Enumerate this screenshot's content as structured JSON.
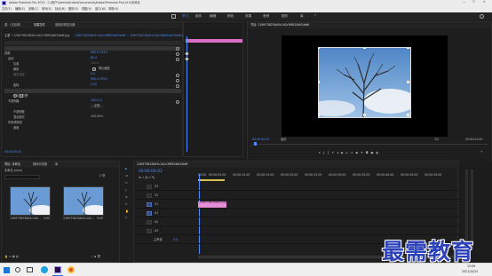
{
  "titlebar": {
    "title": "Adobe Premiere Pro 2020 - C:\\用户\\Administrator\\Documents\\Adobe\\Premiere Pro\\14.0\\未命名"
  },
  "menu": [
    "文件(F)",
    "编辑(E)",
    "剪辑(C)",
    "序列(S)",
    "标记(M)",
    "图形(G)",
    "视图(V)",
    "窗口(W)",
    "帮助(H)"
  ],
  "workspaces": [
    "学习",
    "组件",
    "编辑",
    "颜色",
    "效果",
    "音频",
    "图形",
    "库"
  ],
  "effect_controls": {
    "tabs": [
      "源：(无剪辑)",
      "效果控件",
      "音频剪辑混合器"
    ],
    "source_label": "主要 * 1269738258d3c1d2c3f8924bf24b6f.jpg",
    "clip_label": "1269738258d3c1d2c3f8924bf24b6f ~ 1269738258d3c1d2c3f8924bf24b6f.jpg",
    "rows": [
      {
        "label": "视频",
        "value": ""
      },
      {
        "label": "运动",
        "value": ""
      },
      {
        "label": "位置",
        "value": "960.0   539.0"
      },
      {
        "label": "缩放",
        "value": "85.0"
      },
      {
        "label": "缩放宽度",
        "value": "100.0"
      },
      {
        "label": "等比缩放",
        "value": ""
      },
      {
        "label": "旋转",
        "value": "0.0"
      },
      {
        "label": "锚点",
        "value": "960.0   539.0"
      },
      {
        "label": "防闪烁滤镜",
        "value": "0.00"
      },
      {
        "label": "不透明度",
        "value": ""
      },
      {
        "label": "不透明度",
        "value": "100.0 %"
      },
      {
        "label": "混合模式",
        "value": "正常"
      },
      {
        "label": "时间重映射",
        "value": ""
      },
      {
        "label": "速度",
        "value": "100.00%"
      }
    ],
    "time": "00:00:00:02"
  },
  "program": {
    "tab": "节目: 1269738258d3c1d2c3f8924bf24b6f",
    "timecode_left": "00:00:00:02",
    "fit": "适合",
    "quality": "1/2",
    "timecode_right": "00:00:01:00"
  },
  "project": {
    "tabs": [
      "项目: 未命名",
      "媒体浏览器",
      "库"
    ],
    "path": "未命名.prproj",
    "count": "2 项",
    "items": [
      {
        "name": "1269738258d3c1d2...",
        "duration": "5:00"
      },
      {
        "name": "1269738258d3c1d2...",
        "duration": "5:00"
      }
    ]
  },
  "timeline": {
    "tab": "1269738258d3c1d2c3f8924bf24b6f",
    "timecode": "00:00:00:02",
    "ruler": [
      "00:00",
      "00:00:05:00",
      "00:00:10:00",
      "00:00:15:00",
      "00:00:20:00",
      "00:00:25:00",
      "00:00:30:00",
      "00:00:35:00",
      "00:00:40:00",
      "00:00:45:00",
      "00:00:50:00"
    ],
    "tracks": [
      "V3",
      "V2",
      "V1",
      "A1",
      "A2",
      "A3"
    ],
    "master_label": "主声道",
    "master_value": "0.0",
    "clip_label": "1269738258d3c1d2c3f8924bf24b6f.jpg"
  },
  "watermark": "最需教育",
  "taskbar": {
    "time": "15:06",
    "date": "2021/10/22"
  }
}
